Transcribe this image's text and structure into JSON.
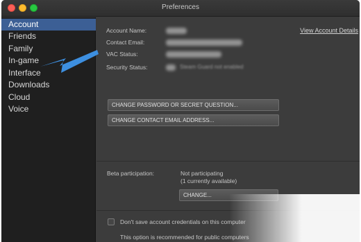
{
  "window": {
    "title": "Preferences"
  },
  "sidebar": {
    "items": [
      {
        "label": "Account",
        "active": true
      },
      {
        "label": "Friends"
      },
      {
        "label": "Family"
      },
      {
        "label": "In-game"
      },
      {
        "label": "Interface"
      },
      {
        "label": "Downloads"
      },
      {
        "label": "Cloud"
      },
      {
        "label": "Voice"
      }
    ]
  },
  "account": {
    "fields": [
      {
        "label": "Account Name:"
      },
      {
        "label": "Contact Email:"
      },
      {
        "label": "VAC Status:"
      },
      {
        "label": "Security Status:",
        "value": "Steam Guard not enabled"
      }
    ],
    "view_details_link": "View Account Details",
    "change_password_button": "CHANGE PASSWORD OR SECRET QUESTION...",
    "change_email_button": "CHANGE CONTACT EMAIL ADDRESS..."
  },
  "beta": {
    "label": "Beta participation:",
    "value": "Not participating",
    "sub": "(1 currently available)",
    "change_button": "CHANGE..."
  },
  "credentials": {
    "checkbox_label": "Don't save account credentials on this computer",
    "checked": false,
    "note": "This option is recommended for public computers"
  },
  "annotation": {
    "arrow_color": "#3d8fe0"
  },
  "colors": {
    "selection": "#3c5f95",
    "sidebar_bg": "#1f1f1f",
    "content_bg": "#3c3c3c"
  }
}
